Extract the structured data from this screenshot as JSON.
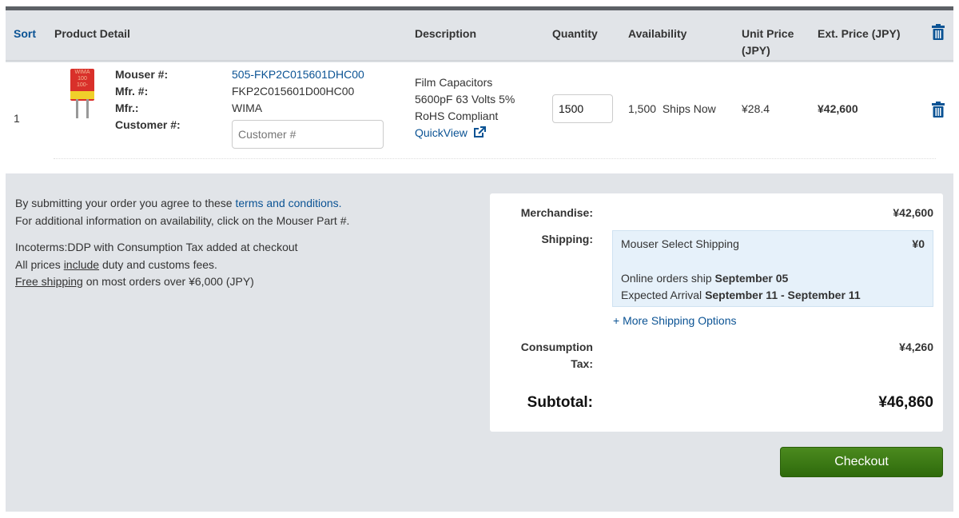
{
  "header": {
    "sort": "Sort",
    "product_detail": "Product Detail",
    "description": "Description",
    "quantity": "Quantity",
    "availability": "Availability",
    "unit_price": "Unit Price (JPY)",
    "unit_price_l1": "Unit Price",
    "unit_price_l2": "(JPY)",
    "ext_price": "Ext. Price (JPY)"
  },
  "item": {
    "index": "1",
    "mouser_label": "Mouser #:",
    "mouser_no": "505-FKP2C015601DHC00",
    "mfr_no_label": "Mfr. #:",
    "mfr_no": "FKP2C015601D00HC00",
    "mfr_label": "Mfr.:",
    "mfr": "WIMA",
    "customer_label": "Customer #:",
    "customer_placeholder": "Customer #",
    "customer_value": "",
    "desc1": "Film Capacitors",
    "desc2": "5600pF 63 Volts 5%",
    "desc3": "RoHS Compliant",
    "quickview": "QuickView",
    "quantity": "1500",
    "avail_qty": "1,500",
    "avail_status": "Ships Now",
    "unit_price": "¥28.4",
    "ext_price": "¥42,600",
    "image_text": "WIMA 100 100-"
  },
  "notes": {
    "terms_prefix": "By submitting your order you agree to these ",
    "terms_link": "terms and conditions.",
    "availability_info": "For additional information on availability, click on the Mouser Part #.",
    "incoterms": "Incoterms:DDP with Consumption Tax added at checkout",
    "prices_prefix": "All prices ",
    "prices_u": "include",
    "prices_suffix": " duty and customs fees.",
    "free_u": "Free shipping",
    "free_suffix": " on most orders over ¥6,000 (JPY)"
  },
  "summary": {
    "merch_label": "Merchandise:",
    "merch": "¥42,600",
    "shipping_label": "Shipping:",
    "ship_method": "Mouser Select Shipping",
    "ship_cost": "¥0",
    "ship_online_prefix": "Online orders ship ",
    "ship_online_date": "September 05",
    "arrival_prefix": "Expected Arrival ",
    "arrival_date": "September 11 - September 11",
    "more_options": "+ More Shipping Options",
    "tax_label_1": "Consumption",
    "tax_label_2": "Tax:",
    "tax": "¥4,260",
    "subtotal_label": "Subtotal:",
    "subtotal": "¥46,860"
  },
  "checkout": "Checkout",
  "colors": {
    "link": "#0b5394",
    "checkout": "#3a7a14",
    "trash": "#0b5394"
  }
}
